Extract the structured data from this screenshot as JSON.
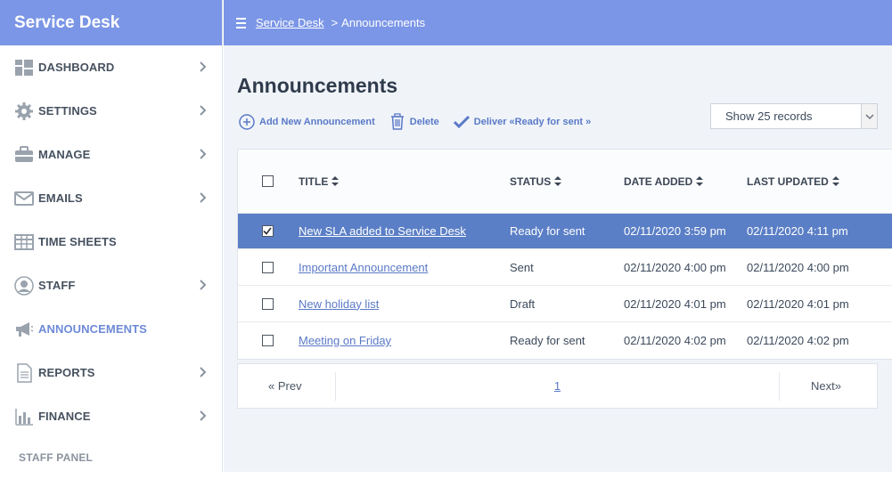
{
  "sidebar": {
    "brand": "Service Desk",
    "items": [
      {
        "label": "DASHBOARD",
        "icon": "dashboard-icon",
        "chevron": true
      },
      {
        "label": "SETTINGS",
        "icon": "gear-icon",
        "chevron": true
      },
      {
        "label": "MANAGE",
        "icon": "briefcase-icon",
        "chevron": true
      },
      {
        "label": "EMAILS",
        "icon": "envelope-icon",
        "chevron": true
      },
      {
        "label": "TIME SHEETS",
        "icon": "table-grid-icon",
        "chevron": false
      },
      {
        "label": "STAFF",
        "icon": "user-icon",
        "chevron": true
      },
      {
        "label": "ANNOUNCEMENTS",
        "icon": "megaphone-icon",
        "chevron": false,
        "active": true
      },
      {
        "label": "REPORTS",
        "icon": "document-icon",
        "chevron": true
      },
      {
        "label": "FINANCE",
        "icon": "bar-chart-icon",
        "chevron": true
      }
    ],
    "section_label": "STAFF PANEL"
  },
  "topbar": {
    "breadcrumb_link": "Service Desk",
    "breadcrumb_separator": ">",
    "breadcrumb_current": "Announcements"
  },
  "main": {
    "title": "Announcements",
    "actions": {
      "add": "Add New Announcement",
      "delete": "Delete",
      "deliver": "Deliver «Ready for sent »"
    },
    "records_select": "Show 25 records",
    "table": {
      "columns": [
        "TITLE",
        "STATUS",
        "DATE ADDED",
        "LAST UPDATED"
      ],
      "rows": [
        {
          "title": "New SLA added to Service Desk",
          "status": "Ready for sent",
          "date_added": "02/11/2020 3:59 pm",
          "last_updated": "02/11/2020 4:11 pm",
          "checked": true
        },
        {
          "title": "Important Announcement",
          "status": "Sent",
          "date_added": "02/11/2020 4:00 pm",
          "last_updated": "02/11/2020 4:00 pm",
          "checked": false
        },
        {
          "title": "New holiday list",
          "status": "Draft",
          "date_added": "02/11/2020 4:01 pm",
          "last_updated": "02/11/2020 4:01 pm",
          "checked": false
        },
        {
          "title": "Meeting on Friday",
          "status": "Ready for sent",
          "date_added": "02/11/2020 4:02 pm",
          "last_updated": "02/11/2020 4:02 pm",
          "checked": false
        }
      ]
    },
    "pagination": {
      "prev": "« Prev",
      "page": "1",
      "next": "Next»"
    }
  },
  "colors": {
    "header_bg": "#7b96e6",
    "selected_row": "#5b7fc6",
    "link": "#5a79c6",
    "main_bg": "#f0f4f9"
  }
}
